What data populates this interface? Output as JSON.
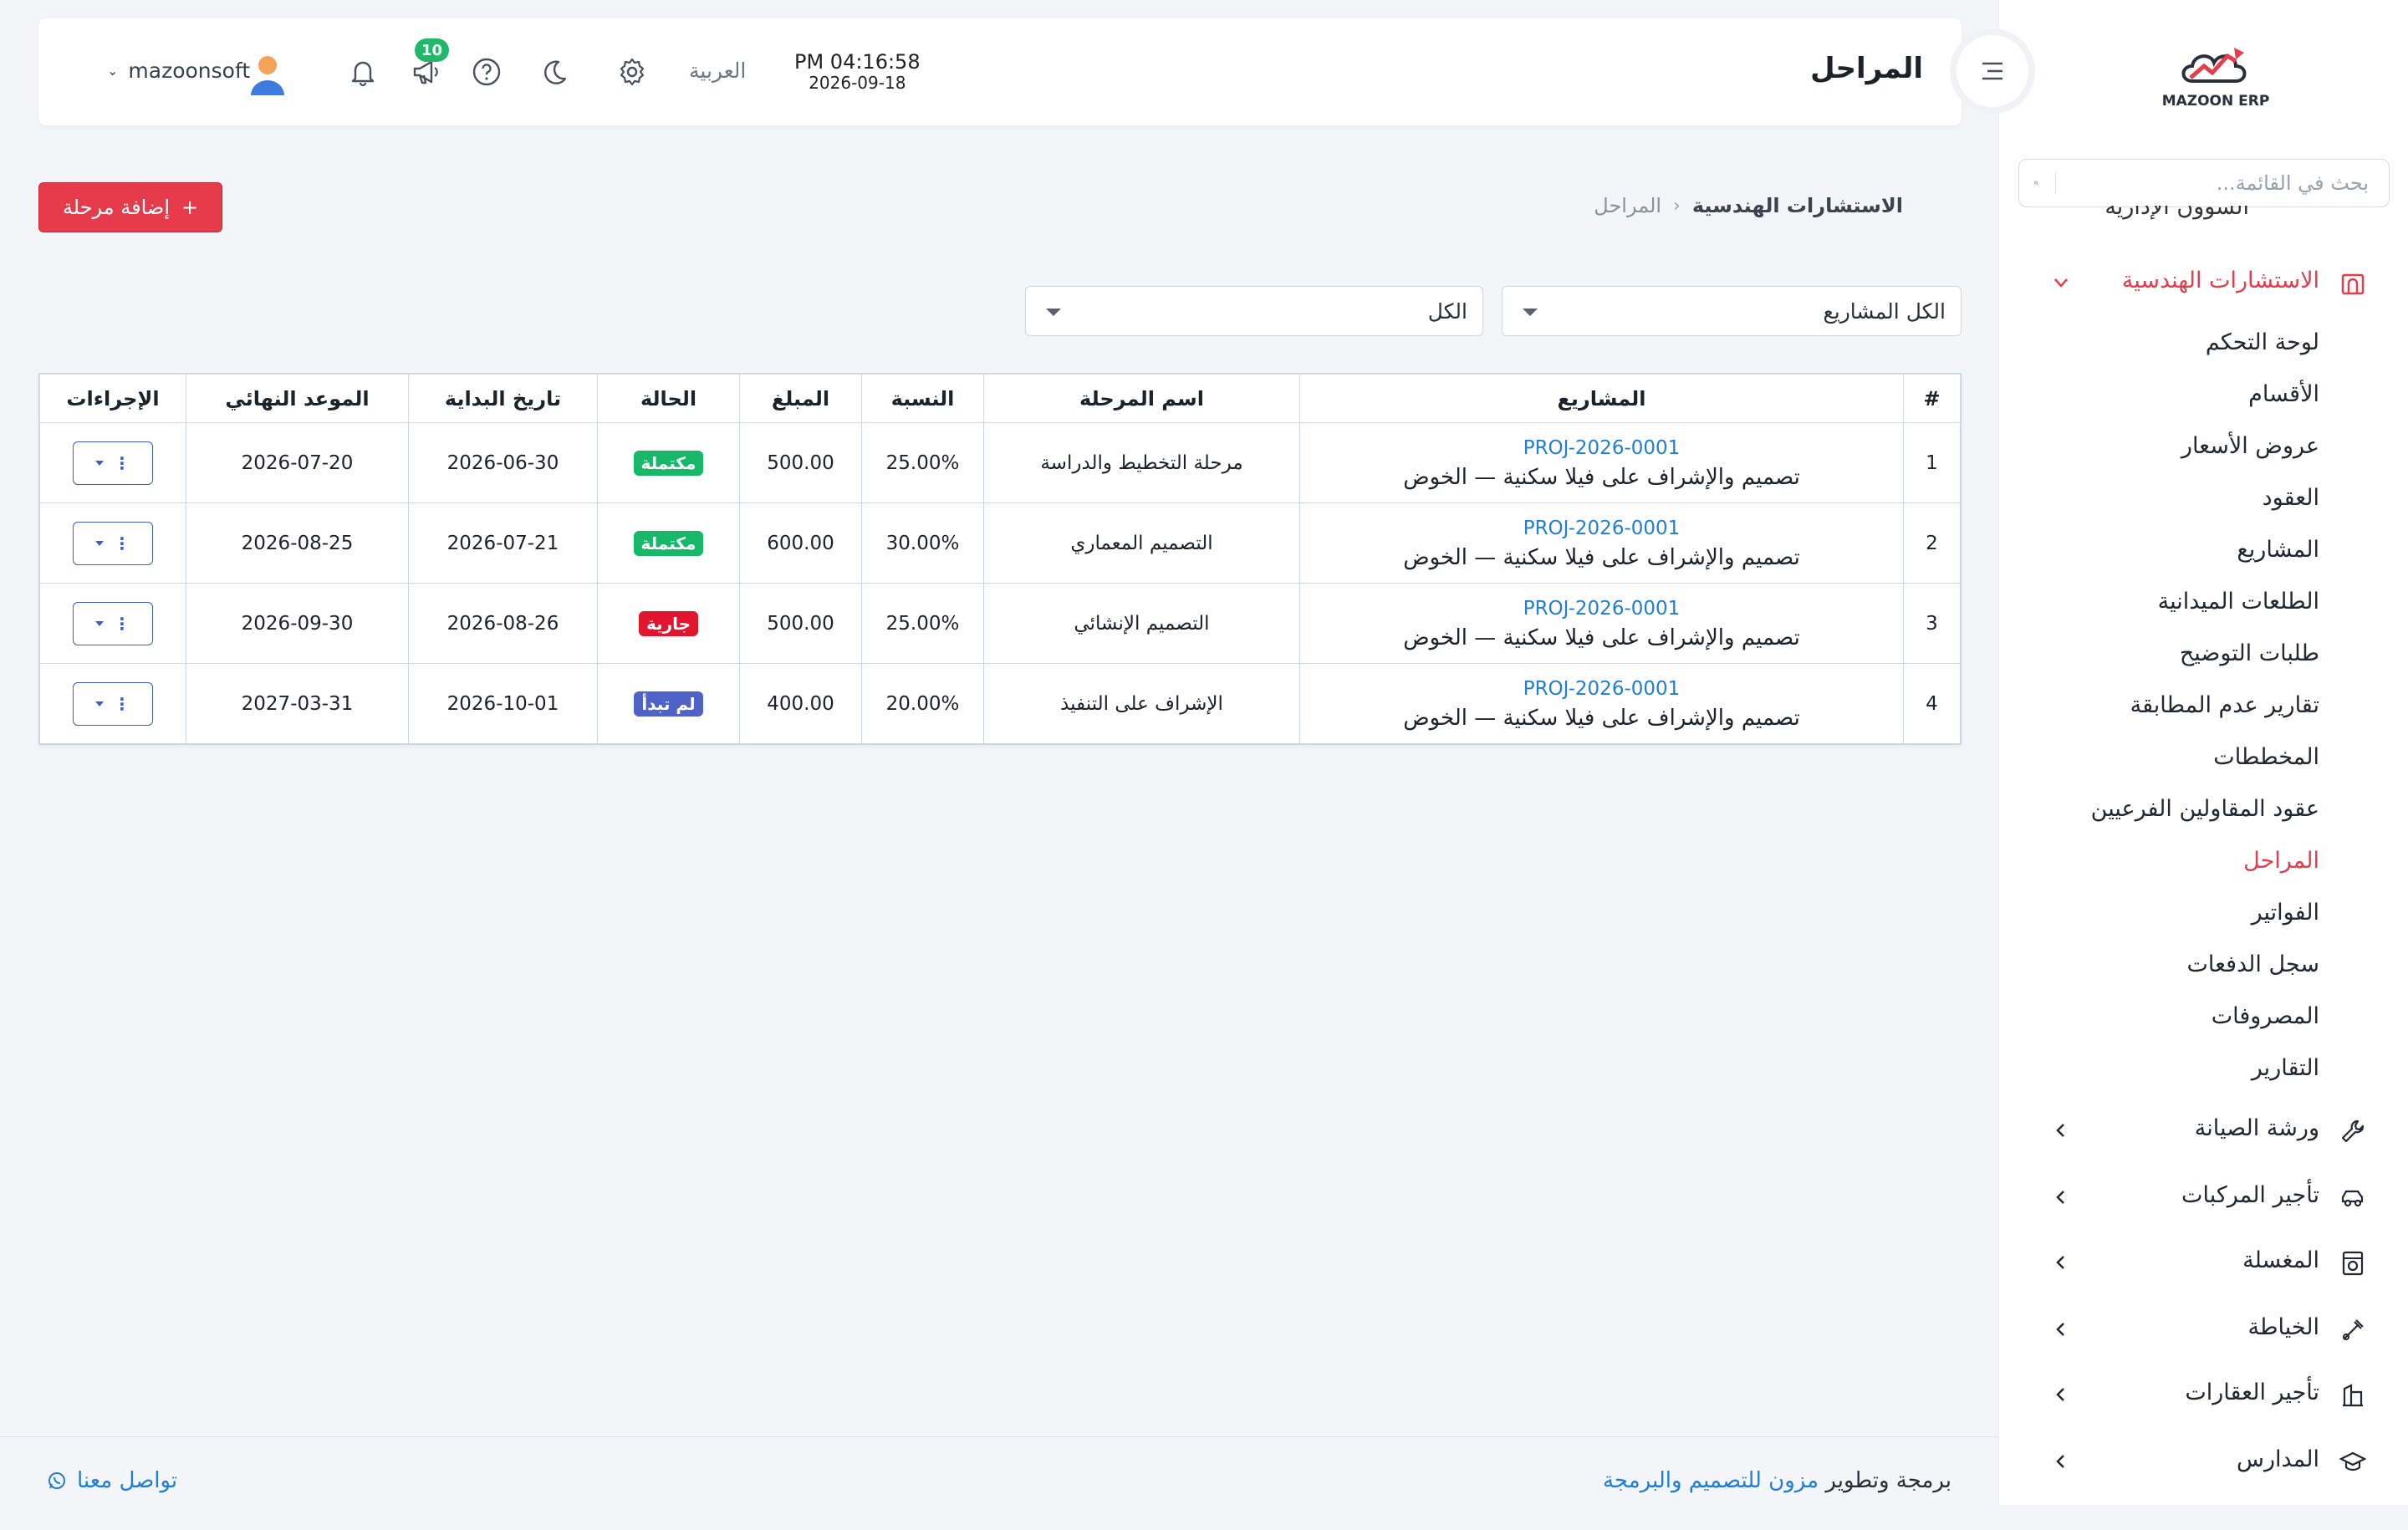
{
  "app": {
    "logo_text": "MAZOON ERP"
  },
  "sidebar": {
    "search_placeholder": "بحث في القائمة...",
    "cut_item_label": "الشؤون الإدارية",
    "active_group": {
      "label": "الاستشارات الهندسية",
      "icon": "building-icon"
    },
    "submenu": [
      "لوحة التحكم",
      "الأقسام",
      "عروض الأسعار",
      "العقود",
      "المشاريع",
      "الطلعات الميدانية",
      "طلبات التوضيح",
      "تقارير عدم المطابقة",
      "المخططات",
      "عقود المقاولين الفرعيين",
      "المراحل",
      "الفواتير",
      "سجل الدفعات",
      "المصروفات",
      "التقارير"
    ],
    "active_submenu": "المراحل",
    "groups": [
      {
        "label": "ورشة الصيانة",
        "icon": "wrench-icon"
      },
      {
        "label": "تأجير المركبات",
        "icon": "car-icon"
      },
      {
        "label": "المغسلة",
        "icon": "laundry-icon"
      },
      {
        "label": "الخياطة",
        "icon": "sewing-icon"
      },
      {
        "label": "تأجير العقارات",
        "icon": "real-estate-icon"
      },
      {
        "label": "المدارس",
        "icon": "graduation-cap-icon"
      }
    ]
  },
  "topbar": {
    "title": "المراحل",
    "time": "PM 04:16:58",
    "date": "2026-09-18",
    "language": "العربية",
    "notification_count": "10",
    "username": "mazoonsoft"
  },
  "breadcrumb": {
    "parent": "الاستشارات الهندسية",
    "current": "المراحل"
  },
  "add_button": {
    "label": "إضافة مرحلة",
    "icon": "+"
  },
  "filters": {
    "project": "الكل المشاريع",
    "status": "الكل"
  },
  "table": {
    "headers": [
      "#",
      "المشاريع",
      "اسم المرحلة",
      "النسبة",
      "المبلغ",
      "الحالة",
      "تاريخ البداية",
      "الموعد النهائي",
      "الإجراءات"
    ],
    "rows": [
      {
        "num": "1",
        "code": "PROJ-2026-0001",
        "project": "تصميم والإشراف على فيلا سكنية — الخوض",
        "stage": "مرحلة التخطيط والدراسة",
        "percent": "25.00%",
        "amount": "500.00",
        "status": "مكتملة",
        "status_color": "#18b86a",
        "start": "2026-06-30",
        "end": "2026-07-20"
      },
      {
        "num": "2",
        "code": "PROJ-2026-0001",
        "project": "تصميم والإشراف على فيلا سكنية — الخوض",
        "stage": "التصميم المعماري",
        "percent": "30.00%",
        "amount": "600.00",
        "status": "مكتملة",
        "status_color": "#18b86a",
        "start": "2026-07-21",
        "end": "2026-08-25"
      },
      {
        "num": "3",
        "code": "PROJ-2026-0001",
        "project": "تصميم والإشراف على فيلا سكنية — الخوض",
        "stage": "التصميم الإنشائي",
        "percent": "25.00%",
        "amount": "500.00",
        "status": "جارية",
        "status_color": "#e1162e",
        "start": "2026-08-26",
        "end": "2026-09-30"
      },
      {
        "num": "4",
        "code": "PROJ-2026-0001",
        "project": "تصميم والإشراف على فيلا سكنية — الخوض",
        "stage": "الإشراف على التنفيذ",
        "percent": "20.00%",
        "amount": "400.00",
        "status": "لم تبدأ",
        "status_color": "#4f62c8",
        "start": "2026-10-01",
        "end": "2027-03-31"
      }
    ]
  },
  "footer": {
    "prefix": "برمجة وتطوير",
    "company_link": "مزون للتصميم والبرمجة",
    "contact": "تواصل معنا"
  }
}
